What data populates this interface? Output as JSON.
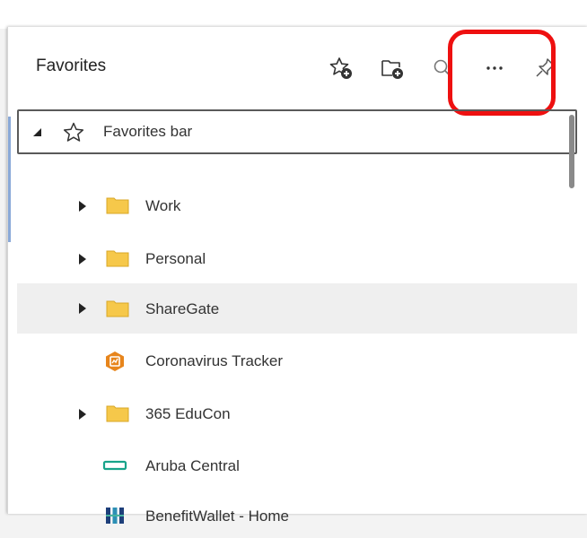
{
  "panel": {
    "title": "Favorites",
    "toolbar": [
      {
        "icon": "add-favorite-icon",
        "label": "Add this page to favorites"
      },
      {
        "icon": "add-folder-icon",
        "label": "Add folder"
      },
      {
        "icon": "search-icon",
        "label": "Search favorites"
      },
      {
        "icon": "more-options-icon",
        "label": "More options"
      },
      {
        "icon": "pin-icon",
        "label": "Pin favorites"
      }
    ]
  },
  "tree": {
    "root": {
      "label": "Favorites bar",
      "expanded": true,
      "icon": "star-outline-icon"
    },
    "items": [
      {
        "label": "Work",
        "type": "folder"
      },
      {
        "label": "Personal",
        "type": "folder"
      },
      {
        "label": "ShareGate",
        "type": "folder",
        "hovered": true
      },
      {
        "label": "Coronavirus Tracker",
        "type": "link",
        "icon": "coronavirus-tracker-favicon"
      },
      {
        "label": "365 EduCon",
        "type": "folder"
      },
      {
        "label": "Aruba Central",
        "type": "link",
        "icon": "aruba-central-favicon"
      },
      {
        "label": "BenefitWallet - Home",
        "type": "link",
        "icon": "benefitwallet-favicon"
      }
    ]
  },
  "colors": {
    "folder": "#f6c84a",
    "highlight": "#ee1010",
    "hover_row": "#efefef",
    "accent": "#2a62b8"
  }
}
